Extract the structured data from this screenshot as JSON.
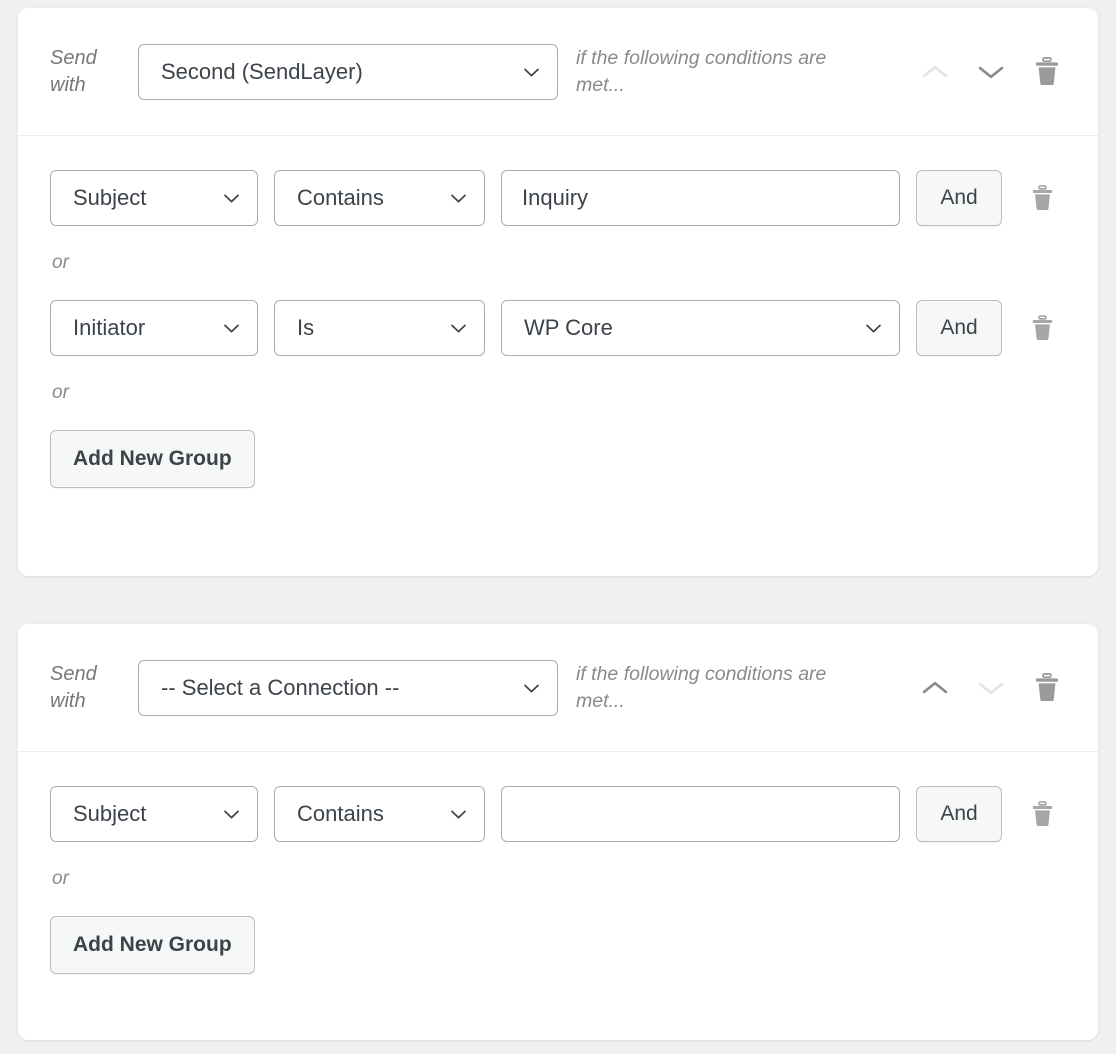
{
  "theme": {
    "page_background": "#f0f0f1",
    "card_background": "#ffffff",
    "border": "#adadad",
    "text": "#3c434a",
    "muted_text": "#8a8a8a",
    "button_background": "#f6f7f7",
    "icon_color": "#9a9a9a",
    "icon_disabled": "#e4e4e4"
  },
  "labels": {
    "send_with": "Send\nwith",
    "conditions_note": "if the following conditions are met...",
    "or": "or",
    "and": "And",
    "add_new_group": "Add New Group",
    "move_up_icon": "chevron-up-icon",
    "move_down_icon": "chevron-down-icon",
    "delete_icon": "trash-icon",
    "dropdown_icon": "chevron-down-icon"
  },
  "connections": [
    {
      "id": "connection-0",
      "send_with": "Send\nwith",
      "connection_value": "Second (SendLayer)",
      "conditions_note": "if the following conditions are met...",
      "move_up_enabled": false,
      "move_down_enabled": true,
      "groups": [
        {
          "rules": [
            {
              "field": "Subject",
              "operator": "Contains",
              "value_type": "text",
              "value": "Inquiry",
              "value_placeholder": "",
              "and_label": "And"
            }
          ],
          "or_label": "or"
        },
        {
          "rules": [
            {
              "field": "Initiator",
              "operator": "Is",
              "value_type": "select",
              "value": "WP Core",
              "value_placeholder": "",
              "and_label": "And"
            }
          ],
          "or_label": "or"
        }
      ],
      "add_new_group": "Add New Group"
    },
    {
      "id": "connection-1",
      "send_with": "Send\nwith",
      "connection_value": "-- Select a Connection --",
      "conditions_note": "if the following conditions are met...",
      "move_up_enabled": true,
      "move_down_enabled": false,
      "groups": [
        {
          "rules": [
            {
              "field": "Subject",
              "operator": "Contains",
              "value_type": "text",
              "value": "",
              "value_placeholder": "",
              "and_label": "And"
            }
          ],
          "or_label": "or"
        }
      ],
      "add_new_group": "Add New Group"
    }
  ]
}
